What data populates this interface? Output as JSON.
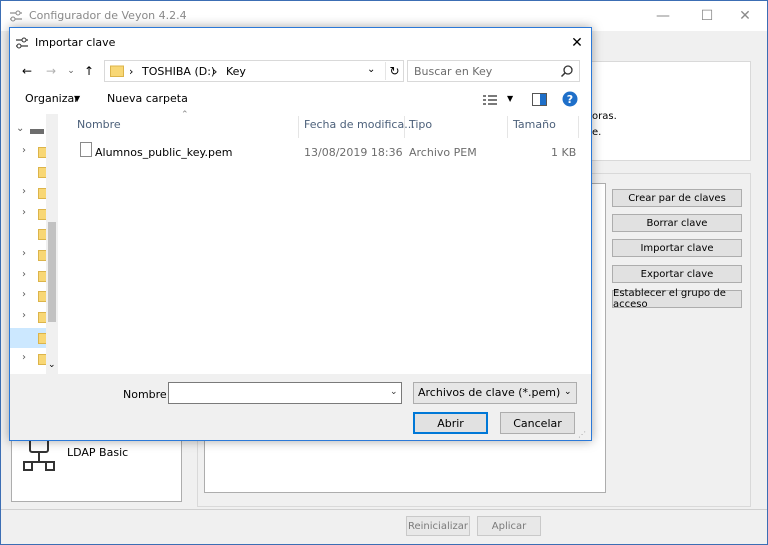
{
  "main_window": {
    "title": "Configurador de Veyon 4.2.4",
    "controls": {
      "minimize": "—",
      "maximize": "☐",
      "close": "✕"
    },
    "right_panel_fragments": [
      "oras.",
      "e."
    ],
    "side_buttons": [
      "Crear par de claves",
      "Borrar clave",
      "Importar clave",
      "Exportar clave",
      "Establecer el grupo de acceso"
    ],
    "ldap_label": "LDAP Basic",
    "bottom_buttons": {
      "reset": "Reinicializar",
      "apply": "Aplicar"
    }
  },
  "dialog": {
    "title": "Importar clave",
    "close": "✕",
    "address": {
      "separator": "›",
      "crumbs": [
        "TOSHIBA (D:)",
        "Key"
      ]
    },
    "search": {
      "placeholder": "Buscar en Key"
    },
    "commands": {
      "organize": "Organizar",
      "new_folder": "Nueva carpeta",
      "help": "?"
    },
    "columns": [
      "Nombre",
      "Fecha de modifica...",
      "Tipo",
      "Tamaño"
    ],
    "files": [
      {
        "name": "Alumnos_public_key.pem",
        "date": "13/08/2019 18:36",
        "type": "Archivo PEM",
        "size": "1 KB"
      }
    ],
    "filename_label": "Nombre:",
    "filename_value": "",
    "file_type": "Archivos de clave (*.pem)",
    "open_label": "Abrir",
    "cancel_label": "Cancelar"
  },
  "colors": {
    "accent": "#0078d7",
    "dialog_border": "#2b79d8",
    "folder": "#f8d775",
    "selection": "#cce8ff"
  }
}
